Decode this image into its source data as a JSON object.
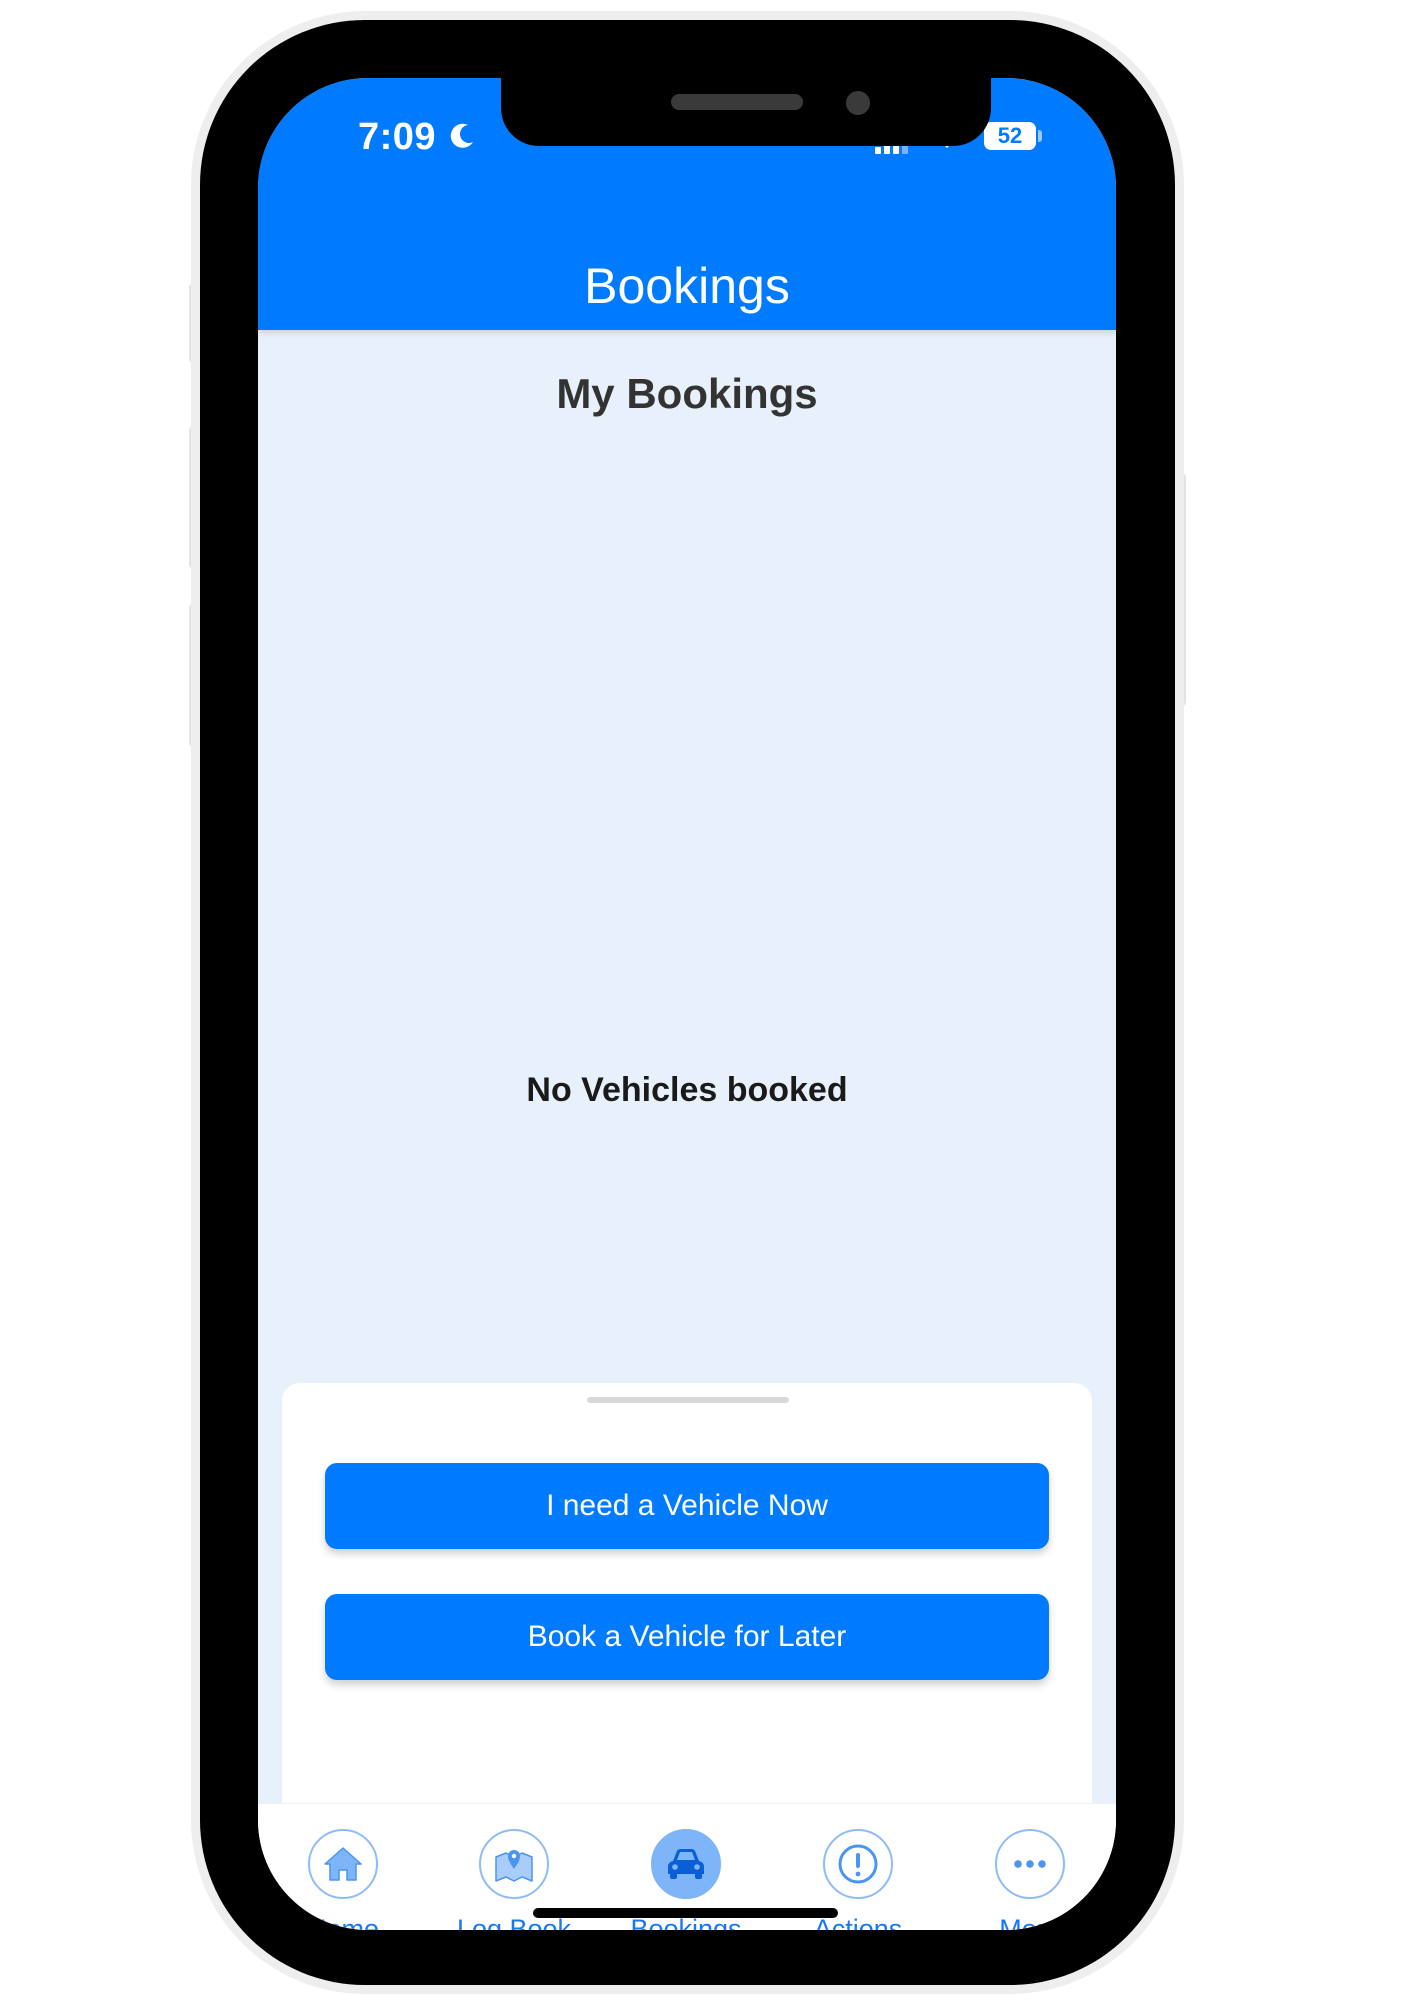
{
  "status_bar": {
    "time": "7:09",
    "battery": "52"
  },
  "header": {
    "title": "Bookings"
  },
  "main": {
    "title": "My Bookings",
    "empty_message": "No Vehicles booked"
  },
  "sheet": {
    "primary_button": "I need a Vehicle Now",
    "secondary_button": "Book a Vehicle for Later"
  },
  "tabs": [
    {
      "label": "Home",
      "icon": "home-icon"
    },
    {
      "label": "Log Book",
      "icon": "map-pin-icon"
    },
    {
      "label": "Bookings",
      "icon": "car-icon",
      "active": true
    },
    {
      "label": "Actions",
      "icon": "alert-circle-icon"
    },
    {
      "label": "More",
      "icon": "ellipsis-icon"
    }
  ],
  "colors": {
    "brand": "#007bff",
    "background": "#e7f0fb",
    "tab_icon_active": "#7db5f8",
    "tab_label": "#1877f2"
  }
}
